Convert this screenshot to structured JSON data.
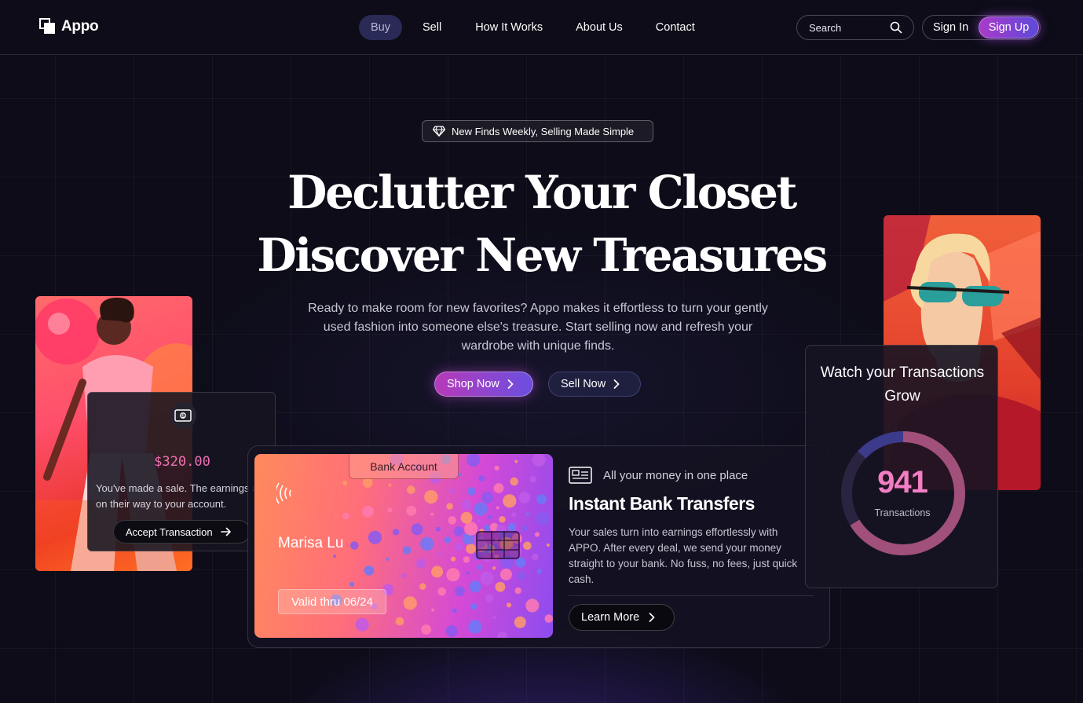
{
  "brand": {
    "name": "Appo"
  },
  "nav": {
    "links": [
      "Buy",
      "Sell",
      "How It Works",
      "About Us",
      "Contact"
    ],
    "search_label": "Search",
    "sign_in": "Sign In",
    "sign_up": "Sign Up"
  },
  "hero": {
    "badge": "New Finds Weekly, Selling Made Simple",
    "title_line1": "Declutter Your Closet",
    "title_line2": "Discover New Treasures",
    "subtitle": "Ready to make room for new favorites? Appo makes it effortless to turn your gently used fashion into someone else's treasure. Start selling now and refresh your wardrobe with unique finds.",
    "shop_button": "Shop Now",
    "sell_button": "Sell Now"
  },
  "sale_card": {
    "amount": "$320.00",
    "text": "You've made a sale. The earnings are on their way to your account.",
    "button": "Accept Transaction"
  },
  "bank": {
    "tab_label": "Bank Account",
    "card_name": "Marisa Lu",
    "card_valid": "Valid thru 06/24",
    "caption": "All your money in one place",
    "title": "Instant Bank Transfers",
    "text": "Your sales turn into earnings effortlessly with APPO. After every deal, we send your money straight to your bank. No fuss, no fees, just quick cash.",
    "button": "Learn More"
  },
  "transactions": {
    "title": "Watch your Transactions Grow",
    "count": "941",
    "label": "Transactions"
  },
  "colors": {
    "accent_pink": "#f27ec4",
    "accent_purple": "#6b4fe0",
    "background": "#0d0c18"
  },
  "icons": [
    "logo-icon",
    "search-icon",
    "diamond-icon",
    "chevron-right-icon",
    "money-icon",
    "arrow-right-icon",
    "contactless-icon",
    "chip-icon",
    "id-card-icon"
  ]
}
